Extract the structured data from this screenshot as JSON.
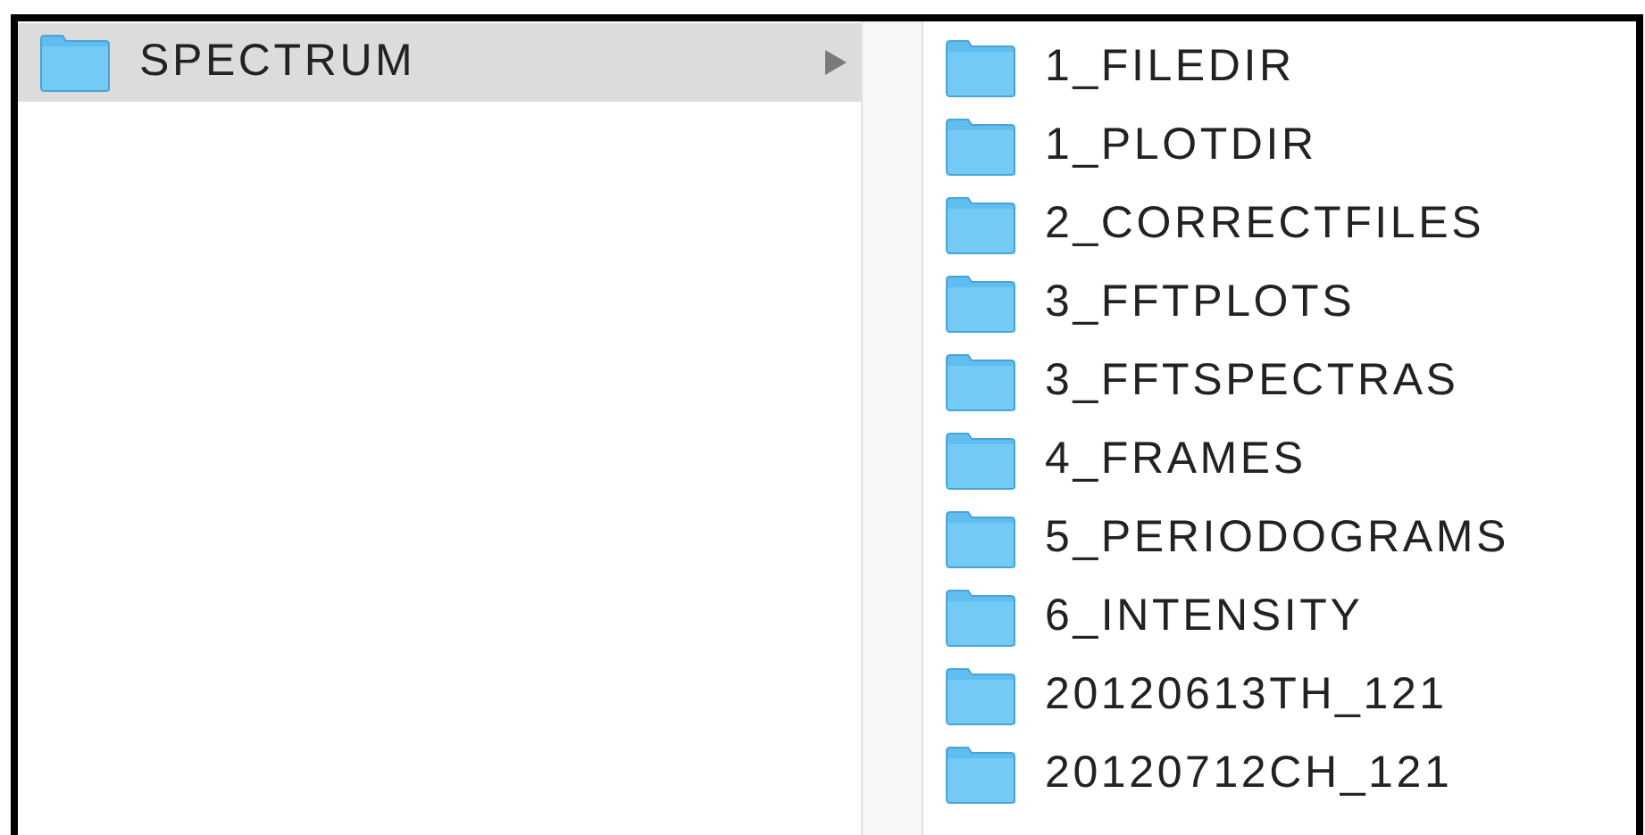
{
  "columns": [
    {
      "items": [
        {
          "name": "SPECTRUM",
          "selected": true,
          "has_children": true
        }
      ]
    },
    {
      "items": [
        {
          "name": "1_FILEDIR",
          "selected": false,
          "has_children": false
        },
        {
          "name": "1_PLOTDIR",
          "selected": false,
          "has_children": false
        },
        {
          "name": "2_CORRECTFILES",
          "selected": false,
          "has_children": false
        },
        {
          "name": "3_FFTPLOTS",
          "selected": false,
          "has_children": false
        },
        {
          "name": "3_FFTSPECTRAS",
          "selected": false,
          "has_children": false
        },
        {
          "name": "4_FRAMES",
          "selected": false,
          "has_children": false
        },
        {
          "name": "5_PERIODOGRAMS",
          "selected": false,
          "has_children": false
        },
        {
          "name": "6_INTENSITY",
          "selected": false,
          "has_children": false
        },
        {
          "name": "20120613TH_121",
          "selected": false,
          "has_children": false
        },
        {
          "name": "20120712CH_121",
          "selected": false,
          "has_children": false
        }
      ]
    }
  ]
}
